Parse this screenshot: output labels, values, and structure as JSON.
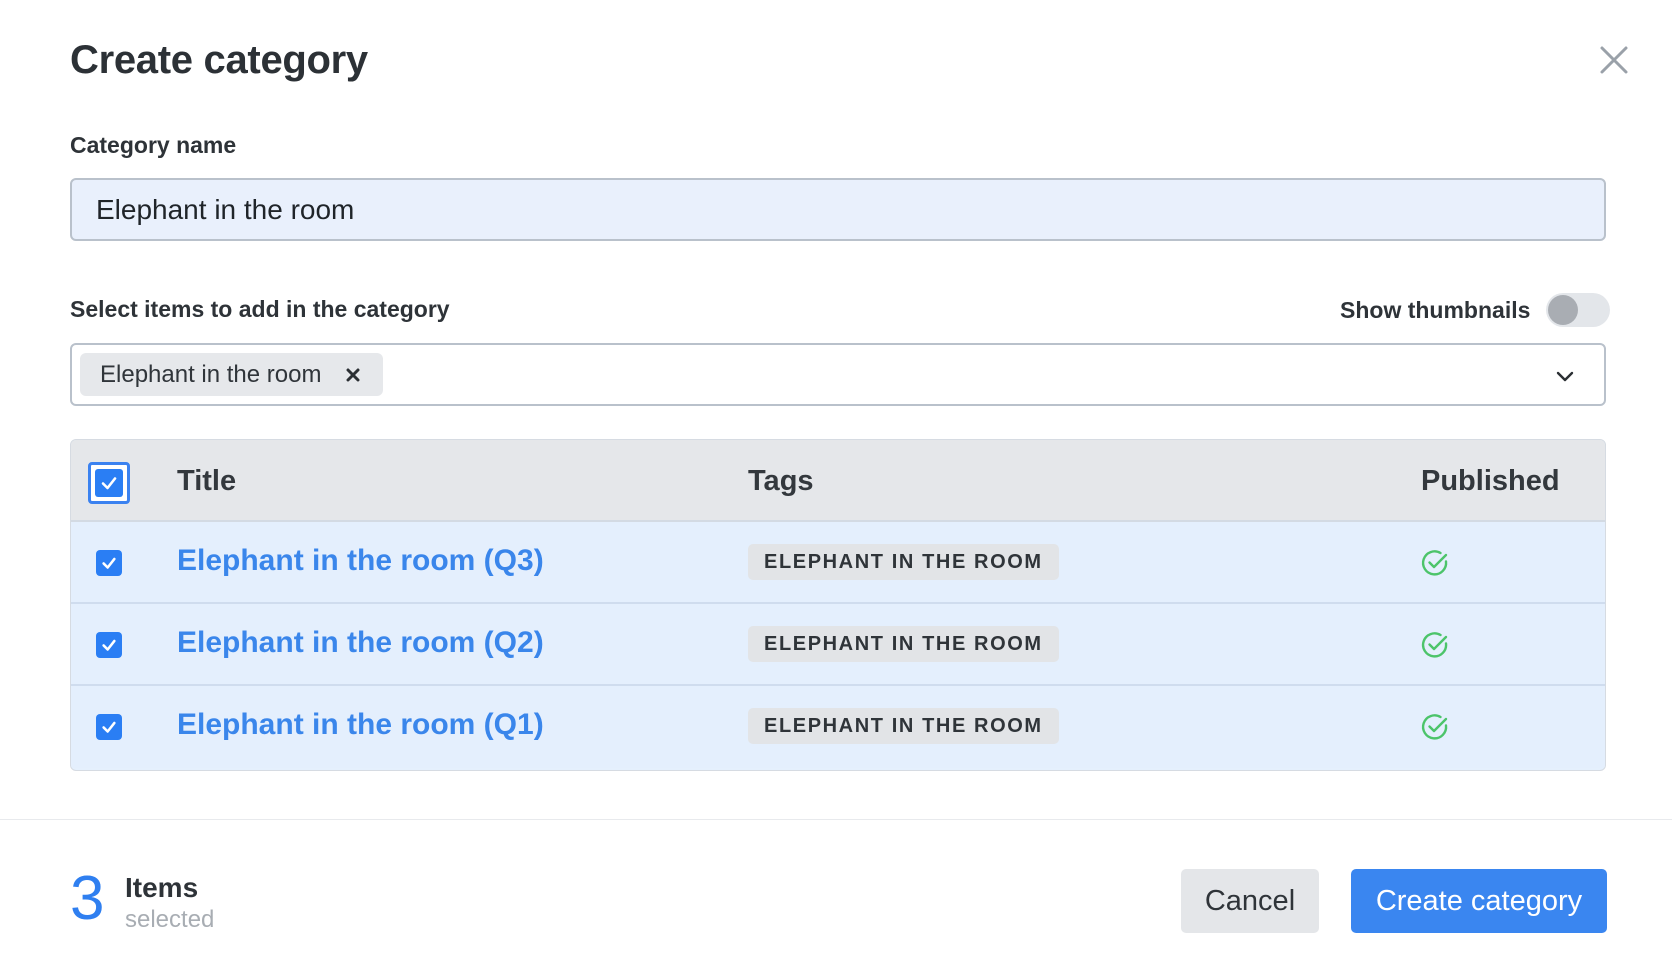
{
  "dialog": {
    "title": "Create category",
    "close_icon": "close-icon"
  },
  "category_name": {
    "label": "Category name",
    "value": "Elephant in the room"
  },
  "items_select": {
    "label": "Select items to add in the category",
    "show_thumbnails_label": "Show thumbnails",
    "show_thumbnails_on": false,
    "selected_chip": "Elephant in the room",
    "chip_remove_icon": "x-icon",
    "dropdown_icon": "chevron-down-icon"
  },
  "table": {
    "columns": {
      "title": "Title",
      "tags": "Tags",
      "published": "Published"
    },
    "header_checked": true,
    "rows": [
      {
        "title": "Elephant in the room (Q3)",
        "tag": "ELEPHANT IN THE ROOM",
        "published": true,
        "checked": true
      },
      {
        "title": "Elephant in the room (Q2)",
        "tag": "ELEPHANT IN THE ROOM",
        "published": true,
        "checked": true
      },
      {
        "title": "Elephant in the room (Q1)",
        "tag": "ELEPHANT IN THE ROOM",
        "published": true,
        "checked": true
      }
    ]
  },
  "footer": {
    "count": "3",
    "count_label": "Items",
    "count_sub": "selected",
    "cancel_label": "Cancel",
    "create_label": "Create category"
  },
  "colors": {
    "accent": "#3a86f0",
    "published_check": "#4cc46a",
    "row_bg": "#e4effd"
  }
}
